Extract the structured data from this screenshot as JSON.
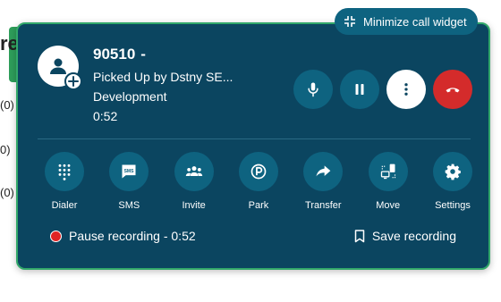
{
  "background": {
    "heading_fragment": "re",
    "row_fragments": [
      "(0)",
      "0)",
      "(0)"
    ]
  },
  "widget": {
    "minimize_label": "Minimize call widget",
    "caller": {
      "number": "90510",
      "separator": "-",
      "status": "Picked Up by Dstny SE...",
      "department": "Development",
      "duration": "0:52"
    },
    "controls": [
      {
        "name": "mute",
        "icon": "microphone-icon"
      },
      {
        "name": "hold",
        "icon": "pause-icon"
      },
      {
        "name": "more",
        "icon": "more-vertical-icon"
      },
      {
        "name": "hangup",
        "icon": "hangup-icon"
      }
    ],
    "actions": [
      {
        "label": "Dialer",
        "icon": "dialpad-icon"
      },
      {
        "label": "SMS",
        "icon": "sms-icon"
      },
      {
        "label": "Invite",
        "icon": "group-icon"
      },
      {
        "label": "Park",
        "icon": "parking-icon"
      },
      {
        "label": "Transfer",
        "icon": "transfer-icon"
      },
      {
        "label": "Move",
        "icon": "move-device-icon"
      },
      {
        "label": "Settings",
        "icon": "gear-icon"
      }
    ],
    "recording": {
      "pause_label": "Pause recording - 0:52",
      "save_label": "Save recording"
    }
  },
  "colors": {
    "widget_bg": "#0b4560",
    "button_bg": "#0e6380",
    "border": "#32a86a",
    "hangup": "#d42b2b",
    "record": "#e02424"
  }
}
